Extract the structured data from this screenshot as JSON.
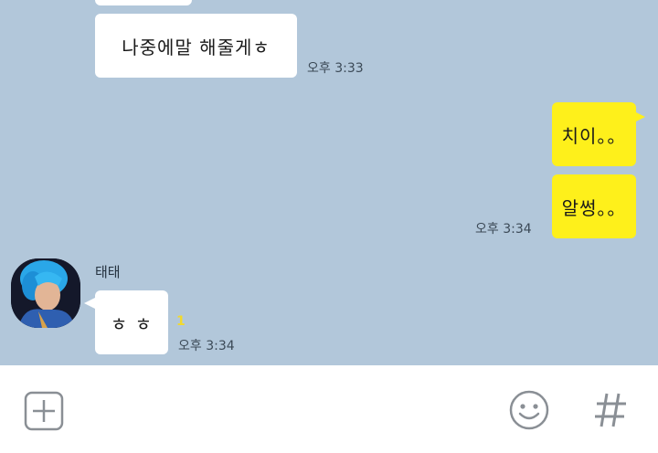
{
  "messages": {
    "m1": {
      "text": "나중에말 해줄게ㅎ",
      "time": "오후 3:33"
    },
    "m2": {
      "text": "치이。。"
    },
    "m3": {
      "text": "알썽。。",
      "time": "오후 3:34"
    },
    "m4": {
      "sender": "태태",
      "text": "ㅎ ㅎ",
      "unread": "1",
      "time": "오후 3:34"
    }
  },
  "input_bar": {
    "add_icon": "plus-square-icon",
    "emoji_icon": "smiley-icon",
    "hash_icon": "hash-icon"
  },
  "colors": {
    "chat_bg": "#b2c7da",
    "my_bubble": "#fef01b",
    "their_bubble": "#ffffff",
    "unread": "#f2d92c"
  }
}
